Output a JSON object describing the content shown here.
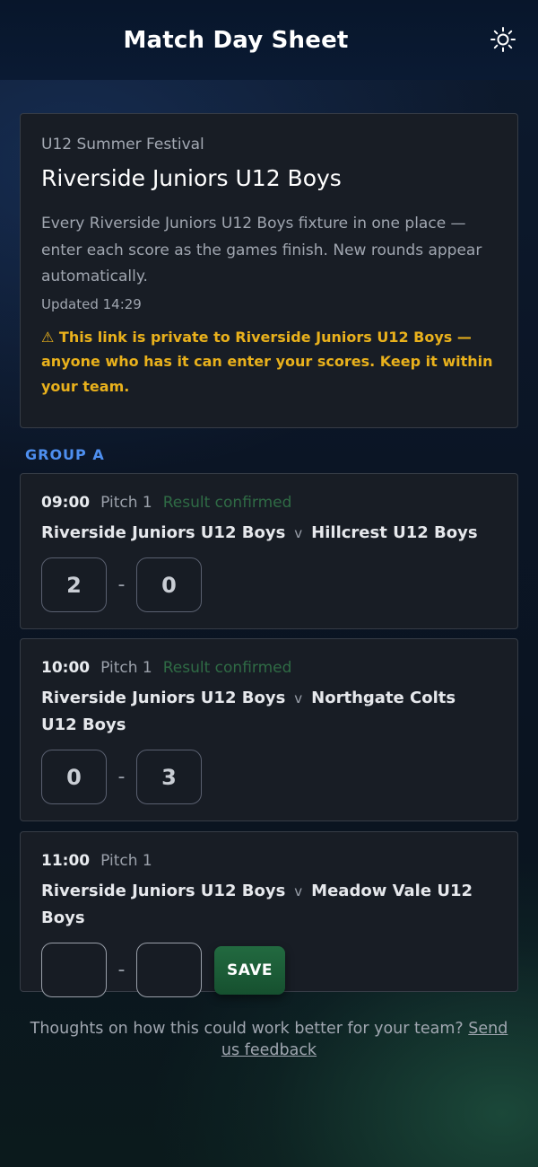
{
  "header": {
    "title": "Match Day Sheet",
    "theme_toggle_icon": "sun-icon"
  },
  "intro": {
    "event": "U12 Summer Festival",
    "team": "Riverside Juniors U12 Boys",
    "description": "Every Riverside Juniors U12 Boys fixture in one place — enter each score as the games finish. New rounds appear automatically.",
    "updated": "Updated 14:29",
    "warning": "⚠ This link is private to Riverside Juniors U12 Boys — anyone who has it can enter your scores. Keep it within your team."
  },
  "group": {
    "label": "GROUP A"
  },
  "matches": [
    {
      "time": "09:00",
      "pitch": "Pitch 1",
      "status": "Result confirmed",
      "home": "Riverside Juniors U12 Boys",
      "vs": "v",
      "away": "Hillcrest U12 Boys",
      "home_score": "2",
      "dash": "-",
      "away_score": "0"
    },
    {
      "time": "10:00",
      "pitch": "Pitch 1",
      "status": "Result confirmed",
      "home": "Riverside Juniors U12 Boys",
      "vs": "v",
      "away": "Northgate Colts U12 Boys",
      "home_score": "0",
      "dash": "-",
      "away_score": "3"
    },
    {
      "time": "11:00",
      "pitch": "Pitch 1",
      "status": "",
      "home": "Riverside Juniors U12 Boys",
      "vs": "v",
      "away": "Meadow Vale U12 Boys",
      "home_score": "",
      "dash": "-",
      "away_score": "",
      "save_label": "SAVE"
    }
  ],
  "footer": {
    "text": "Thoughts on how this could work better for your team?",
    "link": "Send us feedback"
  },
  "colors": {
    "accent_blue": "#4e8ff0",
    "warning_yellow": "#e9b11c",
    "confirmed_green": "#2f6b45",
    "save_green": "#226a40"
  }
}
